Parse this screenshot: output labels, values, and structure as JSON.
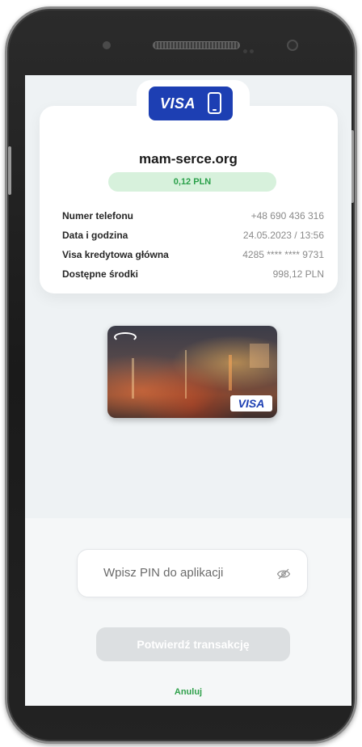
{
  "payment": {
    "card_brand": "VISA",
    "merchant": "mam-serce.org",
    "amount": "0,12 PLN",
    "details": [
      {
        "label": "Numer telefonu",
        "value": "+48 690 436 316"
      },
      {
        "label": "Data i godzina",
        "value": "24.05.2023 / 13:56"
      },
      {
        "label": "Visa kredytowa główna",
        "value": "4285 **** **** 9731"
      },
      {
        "label": "Dostępne środki",
        "value": "998,12 PLN"
      }
    ]
  },
  "card_image": {
    "brand": "VISA"
  },
  "form": {
    "pin_placeholder": "Wpisz PIN do aplikacji",
    "confirm_label": "Potwierdź transakcję",
    "cancel_label": "Anuluj"
  },
  "colors": {
    "brand_blue": "#1d3fb3",
    "accent_green": "#2ea04a",
    "amount_bg": "#d7f1dc",
    "disabled_button": "#dcdfe1"
  },
  "icons": {
    "badge_icon": "smartphone-icon",
    "pin_toggle": "eye-off-icon"
  }
}
